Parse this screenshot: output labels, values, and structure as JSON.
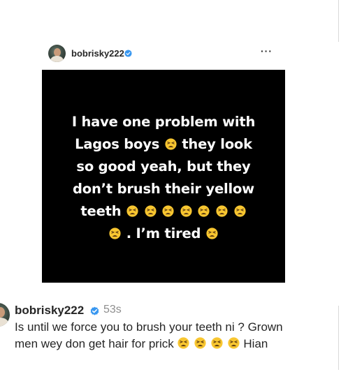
{
  "colors": {
    "background": "#ffffff",
    "post_background": "#000000",
    "post_text": "#ffffff",
    "verified_badge": "#3897f0",
    "muted_text": "#8e8e8e",
    "emoji_fill": "#f8c630"
  },
  "embedded_post": {
    "username": "bobrisky222",
    "verified_icon": "verified-badge-icon",
    "more_icon": "more-options-icon",
    "more_label": "···",
    "image_text": {
      "line1": "I have one problem with",
      "line2_a": "Lagos boys",
      "line2_b": "they look",
      "line3": "so good yeah, but they",
      "line4": "don’t brush their yellow",
      "line5_a": "teeth",
      "line6_b": ". I’m tired"
    },
    "emoji_icon": "tired-face-emoji-icon"
  },
  "caption": {
    "username": "bobrisky222",
    "verified_icon": "verified-badge-icon",
    "timestamp": "53s",
    "line1": "Is until we force you to brush your teeth ni ? Grown",
    "line2_a": "men wey don get hair for prick",
    "line2_b": "Hian"
  }
}
